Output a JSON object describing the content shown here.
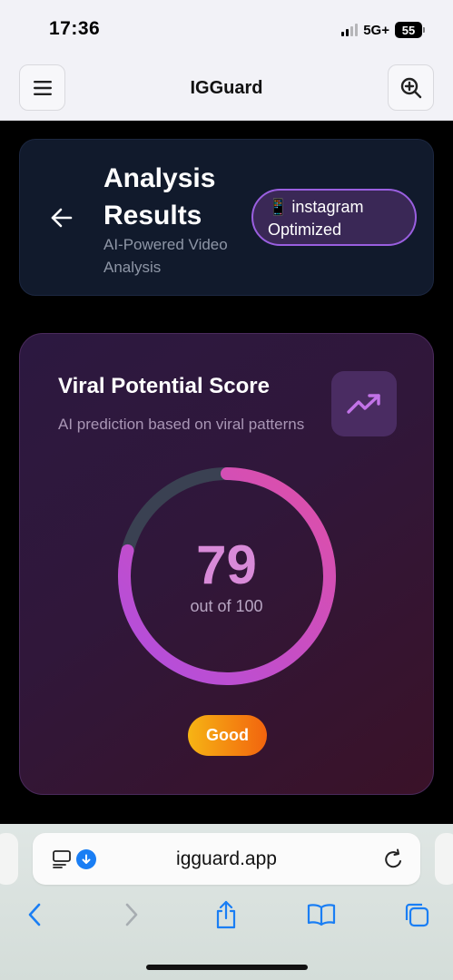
{
  "status_bar": {
    "time": "17:36",
    "network": "5G+",
    "battery": "55"
  },
  "header": {
    "title": "IGGuard",
    "menu_icon": "hamburger-menu-icon",
    "zoom_icon": "zoom-in-icon"
  },
  "results": {
    "title": "Analysis Results",
    "subtitle": "AI-Powered Video Analysis",
    "platform_emoji": "📱",
    "platform_label": "instagram Optimized"
  },
  "score": {
    "title": "Viral Potential Score",
    "subtitle": "AI prediction based on viral patterns",
    "value": "79",
    "caption": "out of 100",
    "progress_fraction": 0.79,
    "rating": "Good",
    "gradient_start": "#e04fa6",
    "gradient_end": "#b04ee0",
    "track_color": "#3a4152"
  },
  "browser": {
    "url": "igguard.app",
    "accent": "#1a7ef4"
  }
}
